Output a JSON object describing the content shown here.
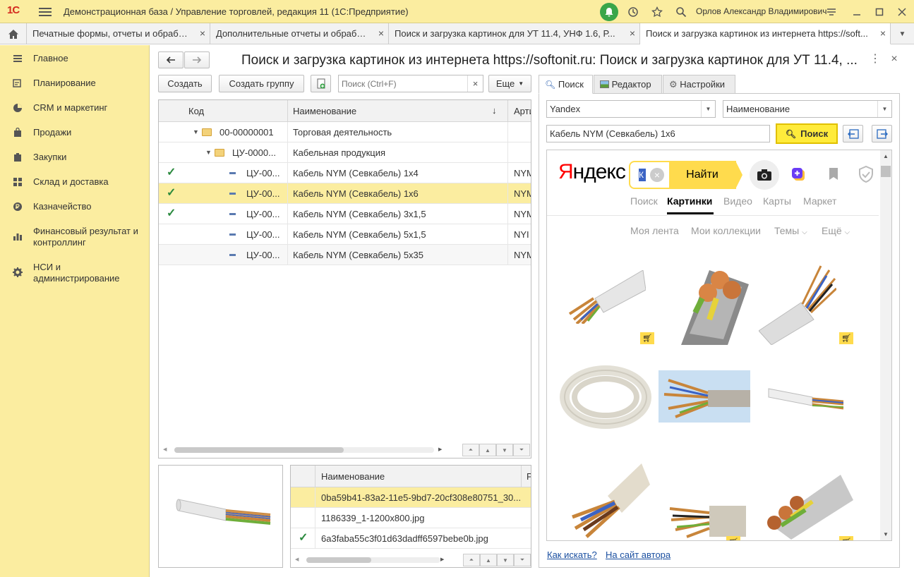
{
  "app": {
    "logo": "1С",
    "title": "Демонстрационная база / Управление торговлей, редакция 11  (1С:Предприятие)",
    "user": "Орлов Александр Владимирович"
  },
  "tabs": [
    {
      "label": "Печатные формы, отчеты и обработки"
    },
    {
      "label": "Дополнительные отчеты и обработки"
    },
    {
      "label": "Поиск и загрузка картинок для УТ 11.4, УНФ 1.6, Р..."
    },
    {
      "label": "Поиск и загрузка картинок из интернета https://soft..."
    }
  ],
  "sidebar": {
    "items": [
      {
        "label": "Главное",
        "icon": "menu-icon"
      },
      {
        "label": "Планирование",
        "icon": "planning-icon"
      },
      {
        "label": "CRM и маркетинг",
        "icon": "pie-chart-icon"
      },
      {
        "label": "Продажи",
        "icon": "bag-icon"
      },
      {
        "label": "Закупки",
        "icon": "cart-icon"
      },
      {
        "label": "Склад и доставка",
        "icon": "warehouse-icon"
      },
      {
        "label": "Казначейство",
        "icon": "coin-icon"
      },
      {
        "label": "Финансовый результат и контроллинг",
        "icon": "bar-chart-icon"
      },
      {
        "label": "НСИ и администрирование",
        "icon": "gear-icon"
      }
    ]
  },
  "form": {
    "title": "Поиск и загрузка картинок из интернета https://softonit.ru: Поиск и загрузка картинок для УТ 11.4, ...",
    "create_label": "Создать",
    "create_group_label": "Создать группу",
    "search_placeholder": "Поиск (Ctrl+F)",
    "more_label": "Еще"
  },
  "items_table": {
    "columns": [
      "Код",
      "Наименование",
      "Арти"
    ],
    "rows": [
      {
        "code": "00-00000001",
        "name": "Торговая деятельность",
        "art": "",
        "checked": false,
        "type": "folder"
      },
      {
        "code": "ЦУ-0000...",
        "name": "Кабельная продукция",
        "art": "",
        "checked": false,
        "type": "folder"
      },
      {
        "code": "ЦУ-00...",
        "name": "Кабель NYM (Севкабель) 1х4",
        "art": "NYM",
        "checked": true,
        "type": "item"
      },
      {
        "code": "ЦУ-00...",
        "name": "Кабель NYM (Севкабель) 1х6",
        "art": "NYM",
        "checked": true,
        "type": "item"
      },
      {
        "code": "ЦУ-00...",
        "name": "Кабель NYM (Севкабель) 3х1,5",
        "art": "NYM",
        "checked": true,
        "type": "item"
      },
      {
        "code": "ЦУ-00...",
        "name": "Кабель NYM (Севкабель) 5х1,5",
        "art": "NYI",
        "checked": false,
        "type": "item"
      },
      {
        "code": "ЦУ-00...",
        "name": "Кабель NYM (Севкабель) 5х35",
        "art": "NYM",
        "checked": false,
        "type": "item"
      }
    ]
  },
  "files_table": {
    "column": "Наименование",
    "column2": "Р",
    "rows": [
      {
        "name": "0ba59b41-83a2-11e5-9bd7-20cf308e80751_30...",
        "checked": false
      },
      {
        "name": "1186339_1-1200x800.jpg",
        "checked": false
      },
      {
        "name": "6a3faba55c3f01d63dadff6597bebe0b.jpg",
        "checked": true
      }
    ]
  },
  "right": {
    "tabs": [
      "Поиск",
      "Редактор",
      "Настройки"
    ],
    "engine": "Yandex",
    "field": "Наименование",
    "query": "Кабель NYM (Севкабель) 1х6",
    "search_button": "Поиск",
    "how_link": "Как искать?",
    "author_link": "На сайт автора"
  },
  "yandex": {
    "logo": "Яндекс",
    "find_button": "Найти",
    "nav": [
      "Поиск",
      "Картинки",
      "Видео",
      "Карты",
      "Маркет"
    ],
    "subnav": [
      "Моя лента",
      "Мои коллекции",
      "Темы",
      "Ещё"
    ]
  },
  "colors": {
    "yellow": "#fbeda0",
    "accent": "#ffdb4d",
    "green": "#2b8a3e"
  }
}
